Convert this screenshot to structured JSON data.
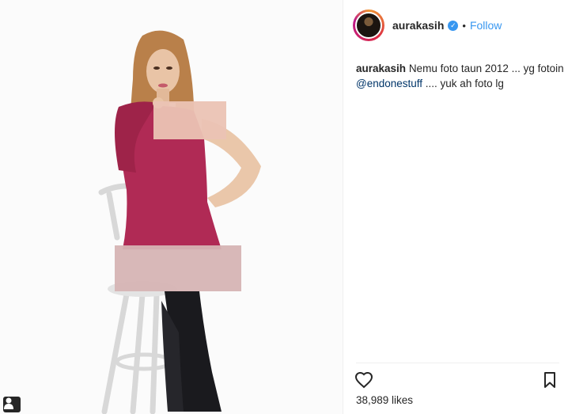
{
  "post": {
    "username": "aurakasih",
    "separator": "•",
    "follow_label": "Follow",
    "caption": {
      "username": "aurakasih",
      "text": "Nemu foto taun 2012 ... yg fotoin",
      "mention": "@endonestuff",
      "text_after_mention": ".... yuk ah foto lg"
    },
    "likes_label": "38,989 likes"
  },
  "icons": {
    "verified": "verified-badge-icon",
    "like": "heart-icon",
    "save": "bookmark-icon",
    "tagged_user": "user-tag-icon"
  },
  "colors": {
    "accent_blue": "#3897f0",
    "mention_blue": "#003569",
    "text": "#262626",
    "dress": "#b02a55"
  }
}
